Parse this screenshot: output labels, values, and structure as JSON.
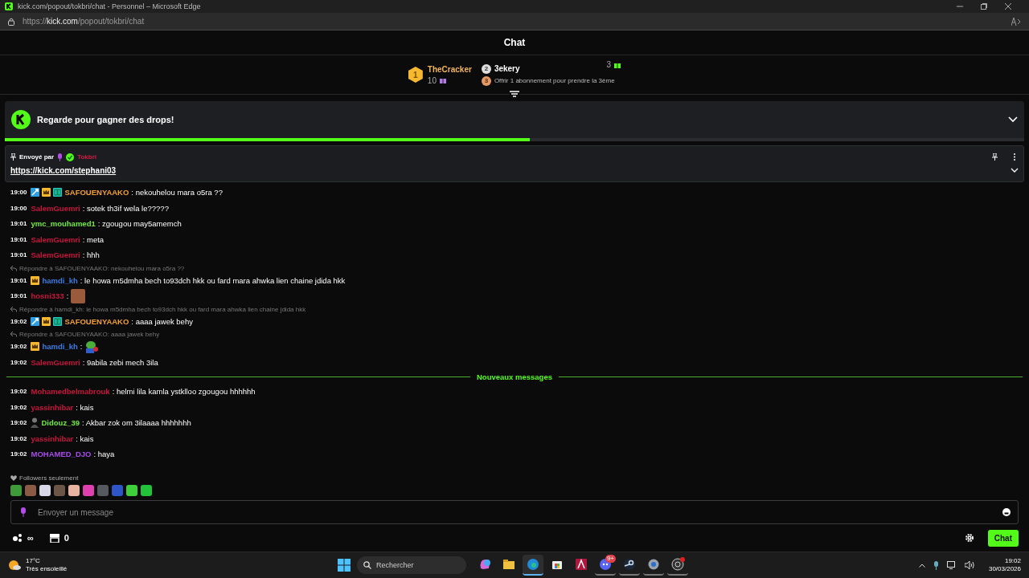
{
  "browser": {
    "title": "kick.com/popout/tokbri/chat - Personnel – Microsoft Edge",
    "url": "https://**kick.com**/popout/tokbri/chat"
  },
  "chat_header": {
    "title": "Chat"
  },
  "leaderboard": {
    "first": {
      "rank": "1",
      "name": "TheCracker",
      "count": "10"
    },
    "second": {
      "rank": "2",
      "name": "3ekery",
      "count": "3"
    },
    "third": {
      "rank": "3",
      "text": "Offrir 1 abonnement pour prendre la 3ème"
    }
  },
  "drops_banner": {
    "title": "Regarde pour gagner des drops!",
    "level": 0.515
  },
  "pinned": {
    "label": "Envoyé par",
    "author": "Tokbri",
    "link": "https://kick.com/stephani03"
  },
  "messages": [
    {
      "time": "19:00",
      "badges": [
        {
          "kind": "mod"
        },
        {
          "kind": "vip"
        },
        {
          "kind": "og"
        }
      ],
      "user": "SAFOUENYAAKO",
      "color": "#f2a033",
      "text": ": nekouhelou mara o5ra ??"
    },
    {
      "time": "19:00",
      "user": "SalemGuemri",
      "color": "#c8163c",
      "text": ": sotek th3if wela le?????"
    },
    {
      "time": "19:01",
      "user": "ymc_mouhamed1",
      "color": "#72e83a",
      "text": ": zgougou may5amemch"
    },
    {
      "time": "19:01",
      "user": "SalemGuemri",
      "color": "#c8163c",
      "text": ": meta"
    },
    {
      "time": "19:01",
      "user": "SalemGuemri",
      "color": "#c8163c",
      "text": ": hhh"
    },
    {
      "time": "19:01",
      "reply": "Répondre à SAFOUENYAAKO: nekouhelou mara o5ra ??",
      "badges": [
        {
          "kind": "vip"
        }
      ],
      "user": "hamdi_kh",
      "color": "#3b7be0",
      "text": ": le howa m5dmha bech to93dch hkk ou fard mara ahwka lien chaine jdida hkk"
    },
    {
      "time": "19:01",
      "user": "hosni333",
      "color": "#c8163c",
      "text": ":",
      "emote": {
        "kind": "photo"
      }
    },
    {
      "time": "19:02",
      "reply": "Répondre à hamdi_kh: le howa m5dmha bech to93dch hkk ou fard mara ahwka lien chaine jdida hkk",
      "badges": [
        {
          "kind": "mod"
        },
        {
          "kind": "vip"
        },
        {
          "kind": "og"
        }
      ],
      "user": "SAFOUENYAAKO",
      "color": "#f2a033",
      "text": ": aaaa jawek behy"
    },
    {
      "time": "19:02",
      "reply": "Répondre à SAFOUENYAAKO: aaaa jawek behy",
      "badges": [
        {
          "kind": "vip"
        }
      ],
      "user": "hamdi_kh",
      "color": "#3b7be0",
      "text": ":",
      "emote": {
        "kind": "frog"
      }
    },
    {
      "time": "19:02",
      "user": "SalemGuemri",
      "color": "#c8163c",
      "text": ": 9abila zebi mech 3ila"
    }
  ],
  "new_divider": "Nouveaux messages",
  "new_messages": [
    {
      "time": "19:02",
      "user": "Mohamedbelmabrouk",
      "color": "#c8163c",
      "text": ": helmi lila kamla ystklloo zgougou hhhhhh"
    },
    {
      "time": "19:02",
      "user": "yassinhibar",
      "color": "#c8163c",
      "text": ": kais"
    },
    {
      "time": "19:02",
      "badges": [
        {
          "kind": "avatar"
        }
      ],
      "user": "Didouz_39",
      "color": "#72e83a",
      "text": ": Akbar zok om 3ilaaaa hhhhhhh"
    },
    {
      "time": "19:02",
      "user": "yassinhibar",
      "color": "#c8163c",
      "text": ": kais"
    },
    {
      "time": "19:02",
      "user": "MOHAMED_DJO",
      "color": "#a64ce8",
      "text": ": haya"
    }
  ],
  "followers_notice": "Followers seulement",
  "emotes": [
    {
      "color": "#3f9a3a"
    },
    {
      "color": "#8a5a45"
    },
    {
      "color": "#d8d8e8"
    },
    {
      "color": "#6a5546"
    },
    {
      "color": "#e8b4a0"
    },
    {
      "color": "#e03fb0"
    },
    {
      "color": "#55585e"
    },
    {
      "color": "#2f56c8"
    },
    {
      "color": "#3fcf3a"
    },
    {
      "color": "#22c23a"
    }
  ],
  "composer": {
    "placeholder": "Envoyer un message"
  },
  "footer": {
    "points": "∞",
    "store_count": "0",
    "send": "Chat"
  },
  "taskbar": {
    "temp": "17°C",
    "weather": "Très ensoleillé",
    "search": "Rechercher",
    "apps": [
      {
        "kind": "copilot",
        "selected": false,
        "running": false
      },
      {
        "kind": "files",
        "selected": false,
        "running": false
      },
      {
        "kind": "edge",
        "selected": true,
        "running": true
      },
      {
        "kind": "store",
        "selected": false,
        "running": false
      },
      {
        "kind": "affinity",
        "selected": false,
        "running": false
      },
      {
        "kind": "discord",
        "selected": false,
        "running": true,
        "badge": "9+"
      },
      {
        "kind": "steam",
        "selected": false,
        "running": true
      },
      {
        "kind": "settings",
        "selected": false,
        "running": true
      },
      {
        "kind": "obs",
        "selected": false,
        "running": true
      }
    ],
    "time": "19:02",
    "date": "30/03/2026"
  }
}
